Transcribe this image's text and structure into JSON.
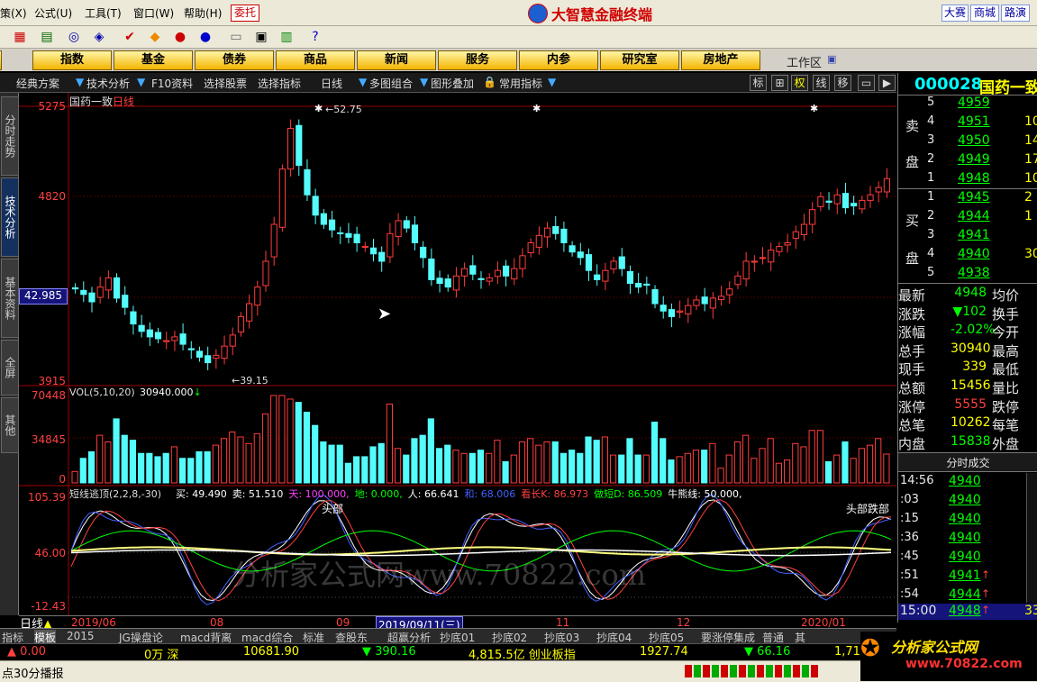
{
  "menu": {
    "items": [
      "策(X)",
      "公式(U)",
      "工具(T)",
      "窗口(W)",
      "帮助(H)"
    ],
    "weituo": "委托",
    "brand": "大智慧金融终端",
    "right_buttons": [
      "大赛",
      "商城",
      "路演"
    ]
  },
  "categories": [
    "指数",
    "基金",
    "债券",
    "商品",
    "新闻",
    "服务",
    "内参",
    "研究室",
    "房地产"
  ],
  "workspace": "工作区",
  "tabs": {
    "items": [
      "经典方案",
      "技术分析",
      "F10资料",
      "选择股票",
      "选择指标",
      "日线",
      "多图组合",
      "图形叠加",
      "常用指标"
    ],
    "right": [
      "标",
      "",
      "权",
      "线",
      "移"
    ]
  },
  "side_tabs": [
    "分时走势",
    "技术分析",
    "基本资料",
    "全屏",
    "其他"
  ],
  "chart": {
    "title": "国药一致",
    "period": "日线",
    "price_axis": [
      "5275",
      "4820",
      "42.985",
      "3915"
    ],
    "high_label": "52.75",
    "low_label": "39.15",
    "vol_title": "VOL(5,10,20)",
    "vol_value": "30940.000",
    "vol_axis": [
      "70448",
      "34845",
      "0"
    ],
    "osc_axis": [
      "105.39",
      "46.00",
      "-12.43"
    ],
    "osc_title": "短线逃顶(2,2,8,-30)",
    "osc_legend": [
      {
        "text": "买: 49.490",
        "color": "#ffffff"
      },
      {
        "text": "卖: 51.510",
        "color": "#ffffff"
      },
      {
        "text": "天: 100.000,",
        "color": "#ff40ff"
      },
      {
        "text": "地: 0.000,",
        "color": "#00ff00"
      },
      {
        "text": "人: 66.641",
        "color": "#ffffff"
      },
      {
        "text": "和: 68.006",
        "color": "#4060ff"
      },
      {
        "text": "看长K: 86.973",
        "color": "#ff4040"
      },
      {
        "text": "做短D: 86.509",
        "color": "#00ff00"
      },
      {
        "text": "牛熊线: 50.000,",
        "color": "#ffffff"
      }
    ],
    "annot_head": "头部",
    "annot_head2": "头部跌部",
    "watermark": "分析家公式网www.70822.com",
    "x_labels": [
      "2019/06",
      "08",
      "09",
      "2019/09/11(三)",
      "11",
      "12",
      "2020/01"
    ]
  },
  "chart_data": {
    "type": "candlestick",
    "title": "国药一致",
    "close": [
      43.5,
      43.2,
      42.8,
      43.6,
      44.1,
      43.0,
      42.5,
      41.6,
      41.2,
      40.9,
      40.8,
      40.7,
      40.9,
      40.5,
      40.2,
      39.8,
      39.5,
      39.9,
      40.4,
      41.0,
      42.0,
      42.7,
      43.6,
      45.0,
      47.0,
      50.0,
      52.2,
      50.2,
      48.6,
      47.5,
      47.0,
      46.7,
      46.5,
      46.3,
      46.0,
      45.8,
      45.4,
      45.0,
      46.5,
      47.2,
      46.8,
      46.0,
      45.2,
      44.0,
      43.8,
      43.6,
      44.2,
      44.6,
      44.3,
      44.0,
      44.1,
      44.5,
      44.2,
      44.6,
      45.3,
      46.0,
      46.4,
      46.8,
      46.5,
      46.0,
      45.5,
      45.2,
      44.5,
      44.0,
      44.5,
      45.0,
      44.6,
      43.8,
      43.6,
      43.7,
      42.7,
      42.3,
      42.0,
      42.3,
      42.6,
      42.9,
      42.7,
      43.0,
      43.1,
      43.5,
      44.2,
      45.0,
      45.0,
      45.2,
      45.6,
      45.8,
      46.0,
      46.6,
      47.0,
      47.8,
      48.5,
      48.2,
      48.6,
      47.9,
      48.0,
      48.3,
      48.6,
      49.0,
      49.48
    ],
    "volume_axis": [
      0,
      34845,
      70448
    ],
    "current_volume": 30940,
    "price_range": [
      39.15,
      52.75
    ],
    "oscillator_range": [
      -12.43,
      105.39
    ]
  },
  "quote": {
    "code": "000028",
    "name": "国药一致",
    "sell_label": [
      "卖",
      "盘"
    ],
    "buy_label": [
      "买",
      "盘"
    ],
    "sell": [
      {
        "lvl": "5",
        "price": "4959",
        "vol": ""
      },
      {
        "lvl": "4",
        "price": "4951",
        "vol": "10"
      },
      {
        "lvl": "3",
        "price": "4950",
        "vol": "14"
      },
      {
        "lvl": "2",
        "price": "4949",
        "vol": "17"
      },
      {
        "lvl": "1",
        "price": "4948",
        "vol": "10"
      }
    ],
    "buy": [
      {
        "lvl": "1",
        "price": "4945",
        "vol": "2"
      },
      {
        "lvl": "2",
        "price": "4944",
        "vol": "1"
      },
      {
        "lvl": "3",
        "price": "4941",
        "vol": ""
      },
      {
        "lvl": "4",
        "price": "4940",
        "vol": "30"
      },
      {
        "lvl": "5",
        "price": "4938",
        "vol": ""
      }
    ],
    "stats": [
      {
        "l": "最新",
        "v": "4948",
        "r": "均价",
        "c": "green"
      },
      {
        "l": "涨跌",
        "v": "▼102",
        "r": "换手",
        "c": "green"
      },
      {
        "l": "涨幅",
        "v": "-2.02%",
        "r": "今开",
        "c": "green"
      },
      {
        "l": "总手",
        "v": "30940",
        "r": "最高",
        "c": "yellow"
      },
      {
        "l": "现手",
        "v": "339",
        "r": "最低",
        "c": "yellow"
      },
      {
        "l": "总额",
        "v": "15456",
        "r": "量比",
        "c": "yellow"
      },
      {
        "l": "涨停",
        "v": "5555",
        "r": "跌停",
        "c": "red"
      },
      {
        "l": "总笔",
        "v": "10262",
        "r": "每笔",
        "c": "yellow"
      },
      {
        "l": "内盘",
        "v": "15838",
        "r": "外盘",
        "c": "green"
      }
    ],
    "ticks_title": "分时成交",
    "ticks": [
      {
        "t": "14:56",
        "p": "4940",
        "up": false
      },
      {
        "t": ":03",
        "p": "4940",
        "up": false
      },
      {
        "t": ":15",
        "p": "4940",
        "up": false
      },
      {
        "t": ":36",
        "p": "4940",
        "up": false
      },
      {
        "t": ":45",
        "p": "4940",
        "up": false
      },
      {
        "t": ":51",
        "p": "4941",
        "up": true
      },
      {
        "t": ":54",
        "p": "4944",
        "up": true
      }
    ],
    "last_tick": {
      "t": "15:00",
      "p": "4948",
      "v": "33"
    }
  },
  "bottom_tabs": [
    "指标",
    "模板",
    "2015",
    "JG操盘论",
    "macd背离",
    "macd综合",
    "标准",
    "查股东",
    "超赢分析",
    "抄底01",
    "抄底02",
    "抄底03",
    "抄底04",
    "抄底05",
    "要涨停集成",
    "普通",
    "其"
  ],
  "period_label": "日线",
  "market": [
    {
      "text": "▲ 0.00",
      "color": "#ff4040"
    },
    {
      "text": "0万 深",
      "color": "#ffff00"
    },
    {
      "text": "10681.90",
      "color": "#ffff00"
    },
    {
      "text": "▼ 390.16",
      "color": "#00ff00"
    },
    {
      "text": "4,815.5亿 创业板指",
      "color": "#ffff00"
    },
    {
      "text": "1927.74",
      "color": "#ffff00"
    },
    {
      "text": "▼ 66.16",
      "color": "#00ff00"
    },
    {
      "text": "1,71",
      "color": "#ffff00"
    }
  ],
  "status": "点30分播报",
  "wm_logo": "分析家公式网",
  "wm_url": "www.70822.com"
}
